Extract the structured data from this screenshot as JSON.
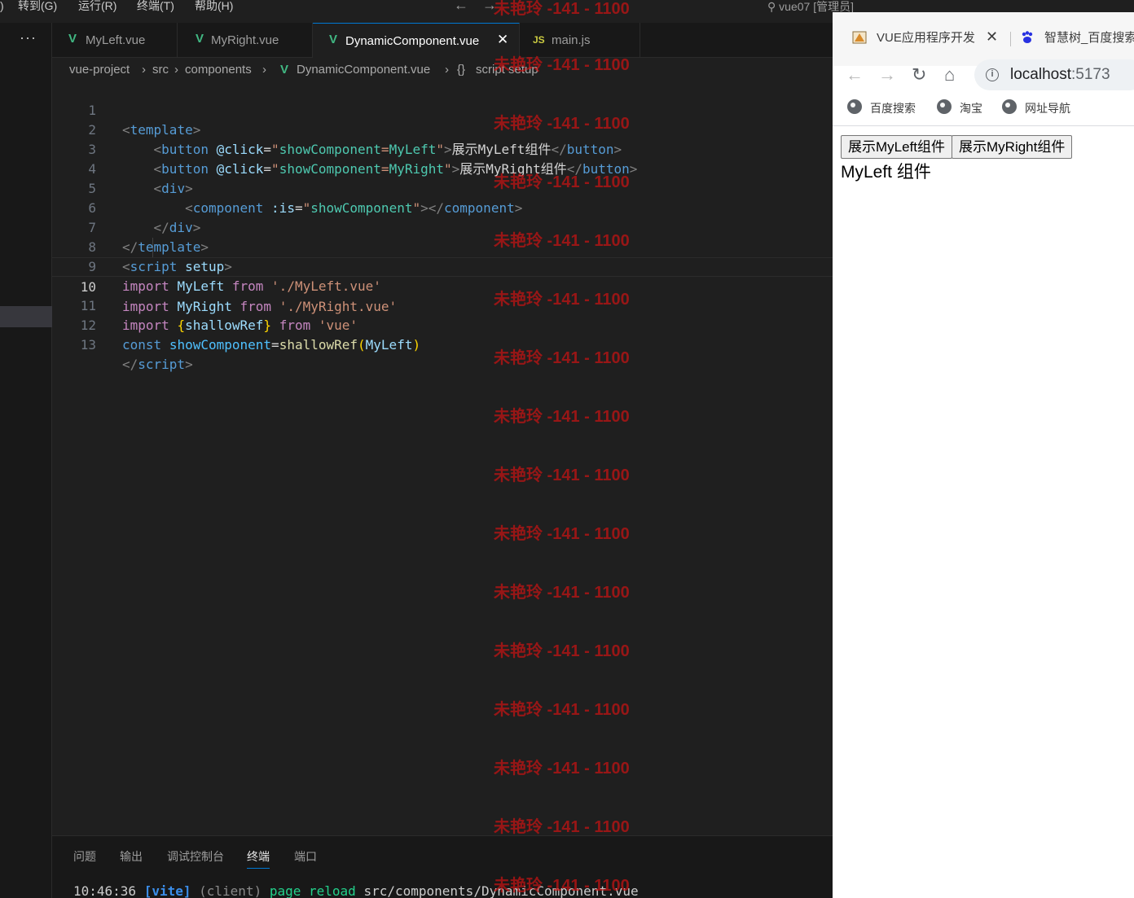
{
  "menubar": {
    "items": [
      "转到(G)",
      "运行(R)",
      "终端(T)",
      "帮助(H)"
    ],
    "back_label": "←",
    "forward_label": "→",
    "search_text": "vue07 [管理员]"
  },
  "activity": {
    "more_label": "···"
  },
  "tabs": [
    {
      "label": "MyLeft.vue",
      "icon": "V"
    },
    {
      "label": "MyRight.vue",
      "icon": "V"
    },
    {
      "label": "DynamicComponent.vue",
      "icon": "V",
      "close": "✕"
    },
    {
      "label": "main.js",
      "icon": "JS"
    }
  ],
  "breadcrumb": {
    "items": [
      "vue-project",
      "src",
      "components",
      "DynamicComponent.vue",
      "script setup"
    ],
    "separator": "›",
    "vue_icon": "V",
    "braces": "{}"
  },
  "code": {
    "line_numbers": [
      "1",
      "2",
      "3",
      "4",
      "5",
      "6",
      "7",
      "8",
      "9",
      "10",
      "11",
      "12",
      "13"
    ],
    "l1": {
      "o": "<",
      "n": "template",
      "c": ">"
    },
    "l2": {
      "o": "<",
      "n": "button",
      "a": "@click",
      "eq": "=",
      "q1": "\"",
      "v1": "showComponent",
      "v2": "=",
      "v3": "MyLeft",
      "q2": "\"",
      "c": ">",
      "text": "展示MyLeft组件",
      "cl": "</",
      "cn": "button",
      "cc": ">"
    },
    "l3": {
      "o": "<",
      "n": "button",
      "a": "@click",
      "eq": "=",
      "q1": "\"",
      "v1": "showComponent",
      "v2": "=",
      "v3": "MyRight",
      "q2": "\"",
      "c": ">",
      "text": "展示MyRight组件",
      "cl": "</",
      "cn": "button",
      "cc": ">"
    },
    "l4": {
      "o": "<",
      "n": "div",
      "c": ">"
    },
    "l5": {
      "o": "<",
      "n": "component",
      "a": ":is",
      "eq": "=",
      "q1": "\"",
      "v": "showComponent",
      "q2": "\"",
      "c": ">",
      "cl": "</",
      "cn": "component",
      "cc": ">"
    },
    "l6": {
      "o": "</",
      "n": "div",
      "c": ">"
    },
    "l7": {
      "o": "</",
      "n": "template",
      "c": ">"
    },
    "l8": {
      "o": "<",
      "n": "script",
      "a": "setup",
      "c": ">"
    },
    "l9": {
      "k1": "import",
      "id": "MyLeft",
      "k2": "from",
      "s": "'./MyLeft.vue'"
    },
    "l10": {
      "k1": "import",
      "id": "MyRight",
      "k2": "from",
      "s": "'./MyRight.vue'"
    },
    "l11": {
      "k1": "import",
      "b1": "{",
      "id": "shallowRef",
      "b2": "}",
      "k2": "from",
      "s": "'vue'"
    },
    "l12": {
      "k": "const",
      "id": "showComponent",
      "eq": "=",
      "fn": "shallowRef",
      "p1": "(",
      "arg": "MyLeft",
      "p2": ")"
    },
    "l13": {
      "o": "</",
      "n": "script",
      "c": ">"
    }
  },
  "panel": {
    "tabs": [
      "问题",
      "输出",
      "调试控制台",
      "终端",
      "端口"
    ],
    "active_tab": "终端",
    "terminal": {
      "time": "10:46:36",
      "vite": "[vite]",
      "client": "(client)",
      "msg": "page reload",
      "path": "src/components/DynamicComponent.vue"
    }
  },
  "watermark": {
    "text": "未艳玲 -141 - 1100",
    "color": "#c81414"
  },
  "browser": {
    "tabs": [
      {
        "title": "VUE应用程序开发",
        "close": "✕"
      },
      {
        "title": "智慧树_百度搜索"
      }
    ],
    "nav": {
      "back": "←",
      "forward": "→",
      "reload": "↻",
      "home": "⌂"
    },
    "omnibox": {
      "host": "localhost",
      "port": ":5173",
      "info_icon": "i"
    },
    "bookmarks": [
      "百度搜索",
      "淘宝",
      "网址导航"
    ],
    "page": {
      "buttons": [
        "展示MyLeft组件",
        "展示MyRight组件"
      ],
      "rendered_text": "MyLeft 组件"
    }
  },
  "colors": {
    "editor_bg": "#1f1f1f",
    "accent": "#0078d4",
    "vue_green": "#41b883"
  }
}
